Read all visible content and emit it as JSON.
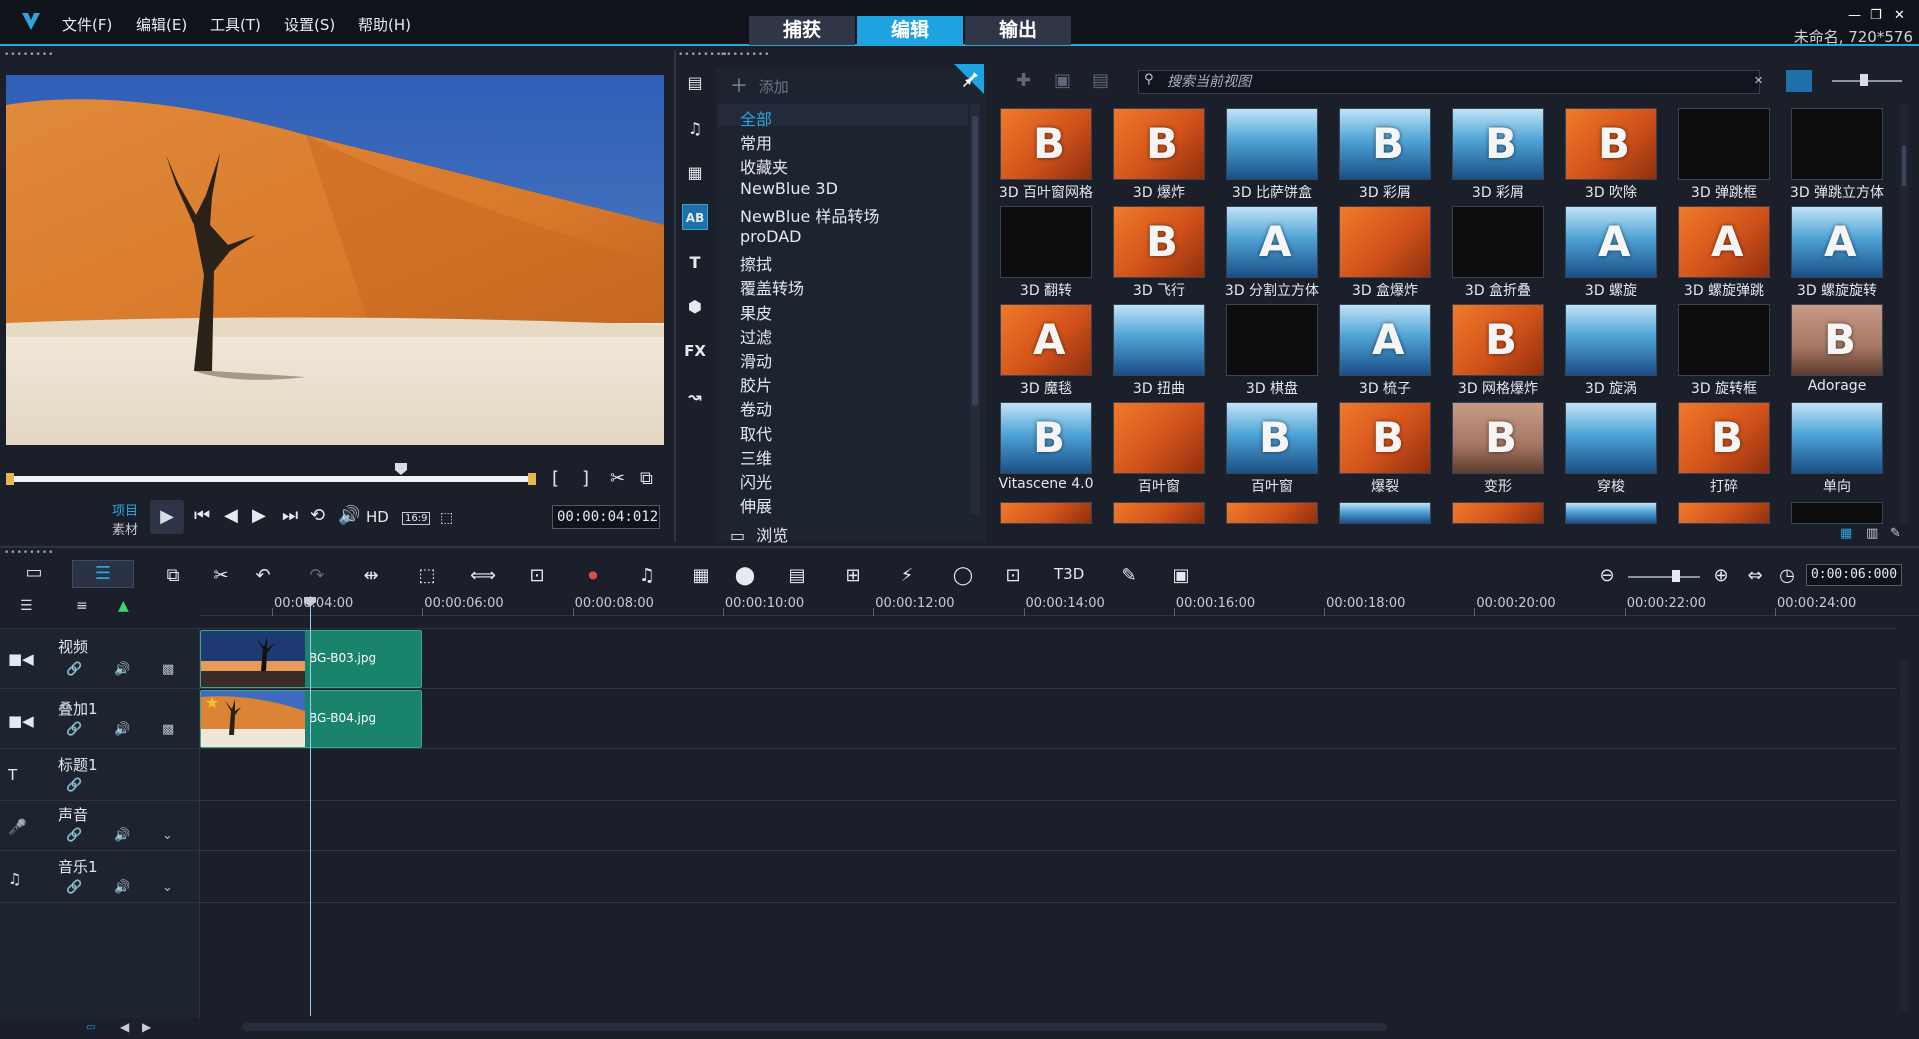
{
  "menu": {
    "file": "文件(F)",
    "edit": "编辑(E)",
    "tools": "工具(T)",
    "settings": "设置(S)",
    "help": "帮助(H)"
  },
  "modes": {
    "capture": "捕获",
    "edit": "编辑",
    "share": "输出"
  },
  "project_info": "未命名, 720*576",
  "preview": {
    "mode_project": "项目",
    "mode_clip": "素材",
    "hd_label": "HD",
    "aspect_label": "16:9",
    "timecode": "00:00:04:012"
  },
  "library": {
    "add_label": "添加",
    "browse_label": "浏览",
    "search_placeholder": "搜索当前视图",
    "categories": [
      "全部",
      "常用",
      "收藏夹",
      "NewBlue 3D",
      "NewBlue 样品转场",
      "proDAD",
      "擦拭",
      "覆盖转场",
      "果皮",
      "过滤",
      "滑动",
      "胶片",
      "卷动",
      "取代",
      "三维",
      "闪光",
      "伸展"
    ],
    "transitions": [
      [
        "3D 百叶窗网格",
        "3D 爆炸",
        "3D 比萨饼盒",
        "3D 彩屑",
        "3D 彩屑",
        "3D 吹除",
        "3D 弹跳框",
        "3D 弹跳立方体"
      ],
      [
        "3D 翻转",
        "3D 飞行",
        "3D 分割立方体",
        "3D 盒爆炸",
        "3D 盒折叠",
        "3D 螺旋",
        "3D 螺旋弹跳",
        "3D 螺旋旋转"
      ],
      [
        "3D 魔毯",
        "3D 扭曲",
        "3D 棋盘",
        "3D 梳子",
        "3D 网格爆炸",
        "3D 旋涡",
        "3D 旋转框",
        "Adorage"
      ],
      [
        "Vitascene 4.0",
        "百叶窗",
        "百叶窗",
        "爆裂",
        "变形",
        "穿梭",
        "打碎",
        "单向"
      ]
    ]
  },
  "timeline": {
    "ruler_labels": [
      "00:00:04:00",
      "00:00:06:00",
      "00:00:08:00",
      "00:00:10:00",
      "00:00:12:00",
      "00:00:14:00",
      "00:00:16:00",
      "00:00:18:00",
      "00:00:20:00",
      "00:00:22:00",
      "00:00:24:00"
    ],
    "project_duration": "0:00:06:000",
    "tracks": [
      {
        "name": "视频",
        "clip": "BG-B03.jpg"
      },
      {
        "name": "叠加1",
        "clip": "BG-B04.jpg"
      },
      {
        "name": "标题1",
        "clip": ""
      },
      {
        "name": "声音",
        "clip": ""
      },
      {
        "name": "音乐1",
        "clip": ""
      }
    ]
  },
  "colors": {
    "accent": "#1fa3e0",
    "clip": "#19836b",
    "background": "#1b1f2a"
  }
}
